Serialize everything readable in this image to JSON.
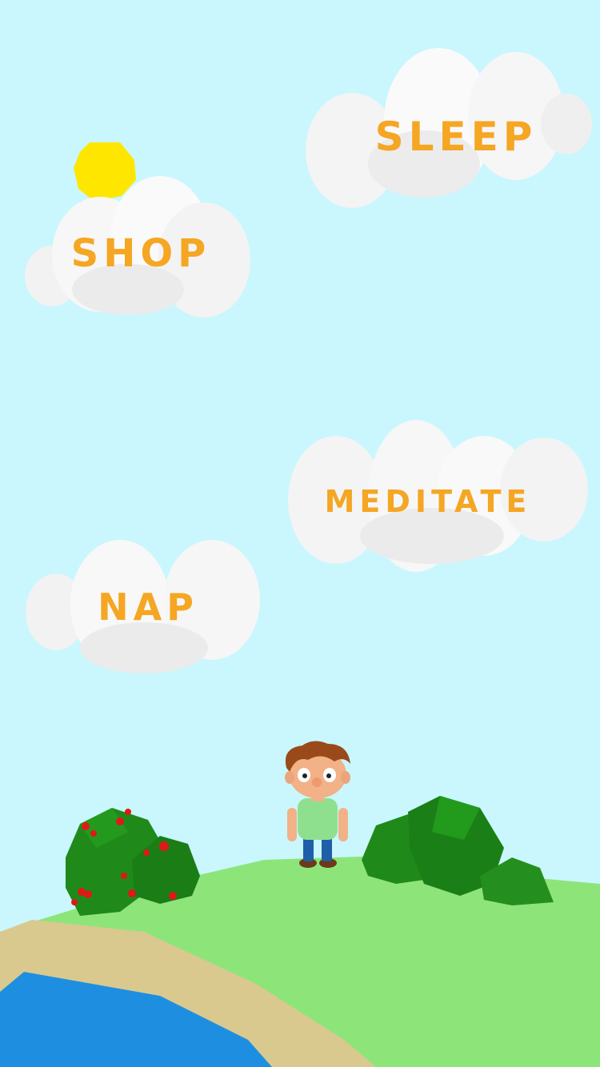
{
  "menu": {
    "sleep": "SLEEP",
    "shop": "SHOP",
    "meditate": "MEDITATE",
    "nap": "NAP"
  },
  "colors": {
    "sky": "#c9f7fd",
    "sun": "#ffe600",
    "cloud": "#f7f7f7",
    "label": "#f5a623",
    "grass": "#8de57a",
    "sand": "#d9c98f",
    "water": "#1e8fe0",
    "bush": "#1f8a1a",
    "berry": "#e01818"
  },
  "icons": {
    "sun": "sun-icon",
    "character": "boy-character",
    "bush_left": "berry-bush",
    "bush_right": "green-bush"
  }
}
